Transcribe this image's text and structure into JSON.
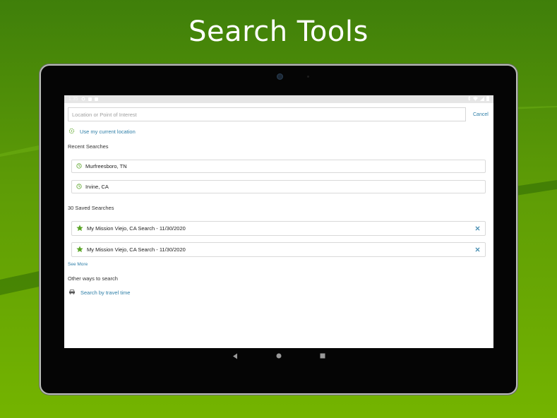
{
  "headline": "Search Tools",
  "status_bar": {
    "time": "1:35"
  },
  "search": {
    "placeholder": "Location or Point of Interest",
    "cancel_label": "Cancel"
  },
  "current_location_label": "Use my current location",
  "recent": {
    "title": "Recent Searches",
    "items": [
      {
        "label": "Murfreesboro, TN"
      },
      {
        "label": "Irvine, CA"
      }
    ]
  },
  "saved": {
    "title": "30 Saved Searches",
    "items": [
      {
        "label": "My Mission Viejo, CA Search - 11/30/2020"
      },
      {
        "label": "My Mission Viejo, CA Search - 11/30/2020"
      }
    ],
    "see_more_label": "See More"
  },
  "other": {
    "title": "Other ways to search",
    "travel_time_label": "Search by travel time"
  },
  "colors": {
    "accent": "#2f7fa8",
    "green_icon": "#5aa526",
    "background_top": "#3f7f0a",
    "background_bottom": "#74b400"
  },
  "icons": {
    "location": "crosshair-icon",
    "recent": "clock-icon",
    "saved": "star-icon",
    "remove": "close-icon",
    "travel": "car-icon"
  }
}
